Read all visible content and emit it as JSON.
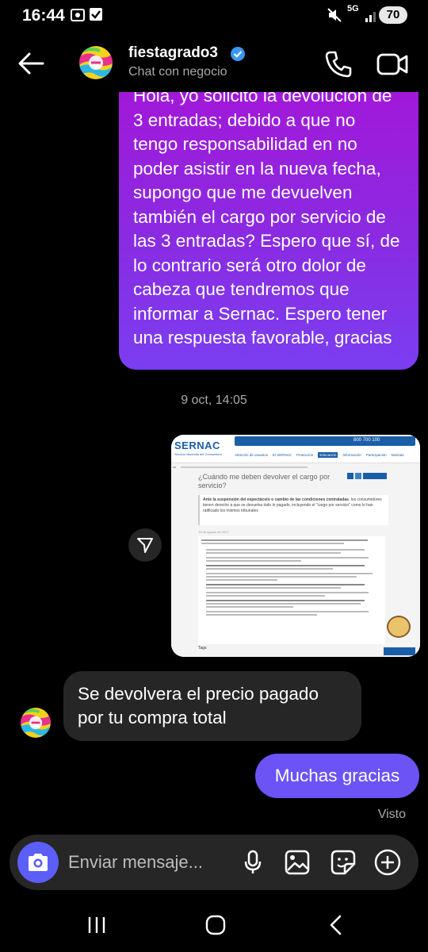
{
  "status_bar": {
    "time": "16:44",
    "battery": "70",
    "network": "5G"
  },
  "header": {
    "name": "fiestagrado3",
    "subtitle": "Chat con negocio"
  },
  "messages": {
    "out_long": "Hola, yo solicito la devolución de 3 entradas; debido a que no tengo responsabilidad en no poder asistir en la nueva fecha, supongo que me devuelven también el cargo por servicio de las 3 entradas? Espero que sí, de lo contrario será otro dolor de cabeza que tendremos que informar a Sernac. Espero tener una respuesta favorable, gracias",
    "timestamp": "9 oct, 14:05",
    "image": {
      "brand": "SERNAC",
      "brand_sub": "Servicio Nacional del Consumidor",
      "phone": "800 700 100",
      "menu": [
        "Atención de usuarios",
        "El SERNAC",
        "Protección",
        "Educación",
        "Información",
        "Participación",
        "Noticias"
      ],
      "title": "¿Cuándo me deben devolver el cargo por servicio?",
      "lead_bold": "Ante la suspensión del espectáculo o cambio de las condiciones contratadas",
      "lead_rest": ", los consumidores tienen derecho a que se devuelva todo lo pagado, incluyendo el \"cargo por servicio\" como lo han ratificado los mismos tribunales",
      "date": "19 de agosto de 2017",
      "tags": "Tags"
    },
    "in": "Se devolvera el precio pagado por tu compra total",
    "out_short": "Muchas gracias",
    "seen": "Visto"
  },
  "composer": {
    "placeholder": "Enviar mensaje..."
  },
  "colors": {
    "bubble_gradient_top": "#a416d8",
    "bubble_gradient_bottom": "#7a3ef0",
    "bubble_out": "#6c53f5",
    "bubble_in": "#262626",
    "verified": "#3897f0"
  }
}
